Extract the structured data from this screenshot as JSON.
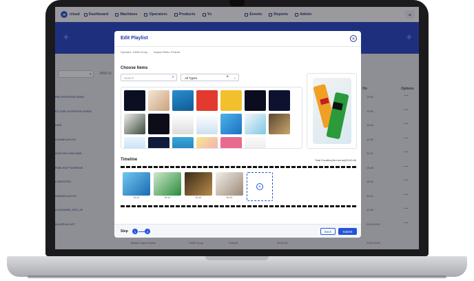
{
  "nav": {
    "brand": "cloud",
    "items": [
      {
        "label": "Dashboard"
      },
      {
        "label": "Machines"
      },
      {
        "label": "Operators"
      },
      {
        "label": "Products"
      },
      {
        "label": "Yo"
      },
      {
        "label": "Events"
      },
      {
        "label": "Reports"
      },
      {
        "label": "Admin"
      }
    ],
    "avatar": "M"
  },
  "background_page": {
    "group_filter": "2468 Gr",
    "columns": {
      "on": "On",
      "options": "Options"
    },
    "rows": [
      {
        "name": "RBI-HYPERION-SIDED",
        "date": "13:40"
      },
      {
        "name": "EZ-2035 (HYPERION SIDED)",
        "date": "13:30"
      },
      {
        "name": "SIDE",
        "date": "16:23"
      },
      {
        "name": "DORMPLAYLIST",
        "date": "12:30"
      },
      {
        "name": "AGRI DEV MACHINE",
        "date": "23:41"
      },
      {
        "name": "RSBI-SIDP SCREENS",
        "date": "16:38"
      },
      {
        "name": "CONVSTEM",
        "date": "16:46"
      },
      {
        "name": "ZZADEPLAYLIST",
        "date": "23:41"
      },
      {
        "name": "UCUD2ADB_2021_25",
        "date": "13:40"
      },
      {
        "name": "NLUSPLAYLIST",
        "date": "2021/11/26"
      }
    ],
    "bottom_row": {
      "owner": "Master Super Admin",
      "group": "2468 Group",
      "aspect": "Portrait",
      "date": "09:31:00",
      "date2": "2021/11/26"
    }
  },
  "modal": {
    "title": "Edit Playlist",
    "operator": "Operator: 2468 Group",
    "aspect": "Aspect Ratio: Portrait",
    "choose_items": "Choose Items",
    "search_placeholder": "Search",
    "type_select": "All Types",
    "timeline_label": "Timeline",
    "total_duration": "Total Duration(hh:mm:ss)00:00:46",
    "clips": [
      {
        "time": "00:10"
      },
      {
        "time": "00:10"
      },
      {
        "time": "00:10"
      },
      {
        "time": "00:10"
      }
    ],
    "step_label": "Step",
    "steps": [
      "1",
      "2"
    ],
    "back_label": "Back",
    "submit_label": "Submit"
  },
  "colors": {
    "primary": "#2553d8",
    "banner": "#1e3fc4",
    "title": "#1f35a8"
  }
}
